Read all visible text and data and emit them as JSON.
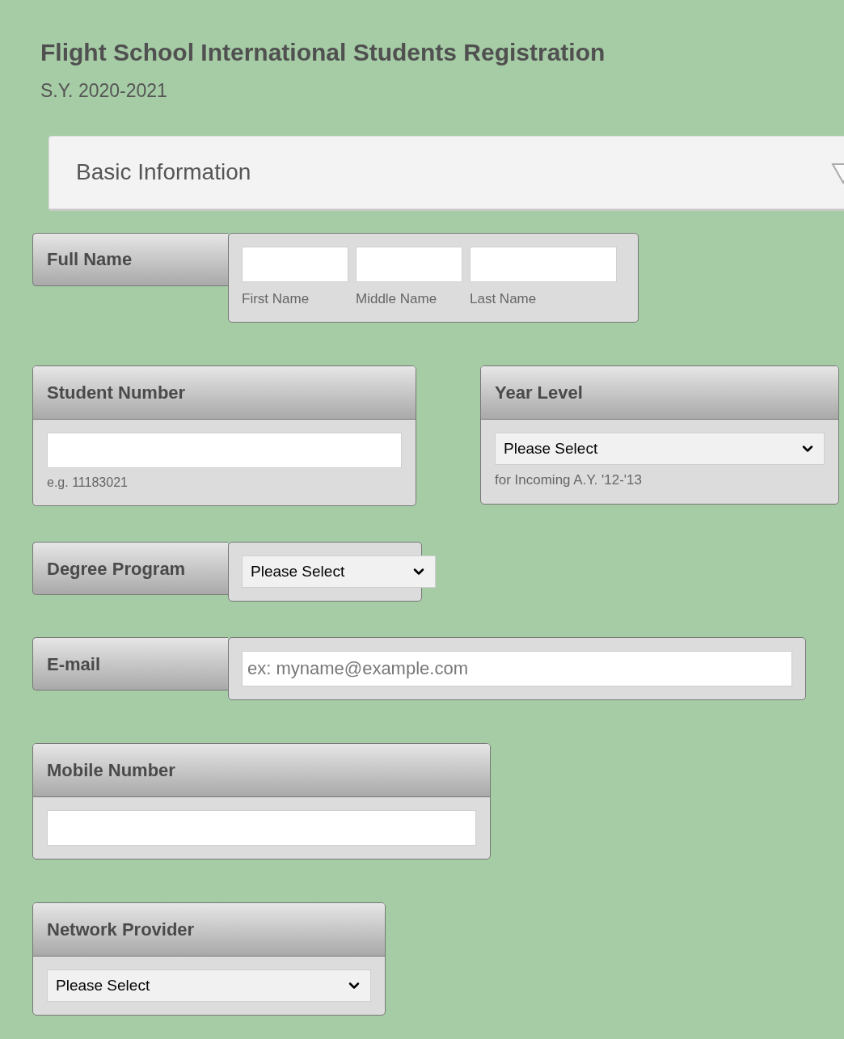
{
  "title": "Flight School International Students Registration",
  "subtitle": "S.Y. 2020-2021",
  "section": {
    "title": "Basic Information"
  },
  "rows": [
    [
      {
        "kind": "inline",
        "label": "Full Name",
        "control": {
          "kind": "name-group",
          "parts": [
            {
              "hint": "First Name"
            },
            {
              "hint": "Middle Name"
            },
            {
              "hint": "Last Name"
            }
          ]
        }
      }
    ],
    [
      {
        "kind": "stacked",
        "label": "Student Number",
        "control": {
          "kind": "text",
          "hint": "e.g. 11183021"
        }
      },
      {
        "kind": "stacked",
        "label": "Year Level",
        "control": {
          "kind": "select",
          "value": "Please Select",
          "hint": "for Incoming A.Y. '12-'13"
        }
      }
    ],
    [
      {
        "kind": "inline",
        "label": "Degree Program",
        "control": {
          "kind": "select",
          "value": "Please Select"
        }
      }
    ],
    [
      {
        "kind": "inline",
        "label": "E-mail",
        "control": {
          "kind": "text",
          "placeholder": "ex: myname@example.com"
        }
      }
    ],
    [
      {
        "kind": "stacked",
        "label": "Mobile Number",
        "control": {
          "kind": "text"
        }
      }
    ],
    [
      {
        "kind": "stacked",
        "label": "Network Provider",
        "control": {
          "kind": "select",
          "value": "Please Select"
        }
      }
    ]
  ]
}
